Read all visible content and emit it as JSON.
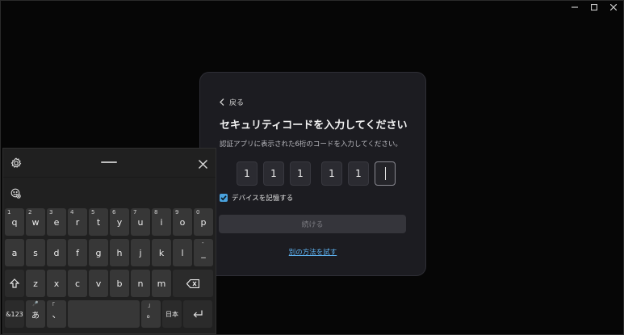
{
  "window": {
    "controls": [
      "minimize-icon",
      "maximize-icon",
      "close-icon"
    ]
  },
  "dialog": {
    "back_label": "戻る",
    "title": "セキュリティコードを入力してください",
    "subtitle": "認証アプリに表示された6桁のコードを入力してください。",
    "digits": [
      "1",
      "1",
      "1",
      "1",
      "1",
      ""
    ],
    "remember_label": "デバイスを記憶する",
    "remember_checked": true,
    "continue_label": "続ける",
    "other_method_link": "別の方法を試す",
    "accent_color": "#4aa3df",
    "link_color": "#5db0ee"
  },
  "keyboard": {
    "row1": [
      {
        "k": "q",
        "s": "1"
      },
      {
        "k": "w",
        "s": "2"
      },
      {
        "k": "e",
        "s": "3"
      },
      {
        "k": "r",
        "s": "4"
      },
      {
        "k": "t",
        "s": "5"
      },
      {
        "k": "y",
        "s": "6"
      },
      {
        "k": "u",
        "s": "7"
      },
      {
        "k": "i",
        "s": "8"
      },
      {
        "k": "o",
        "s": "9"
      },
      {
        "k": "p",
        "s": "0"
      }
    ],
    "row2": [
      {
        "k": "a",
        "s": ""
      },
      {
        "k": "s",
        "s": ""
      },
      {
        "k": "d",
        "s": ""
      },
      {
        "k": "f",
        "s": ""
      },
      {
        "k": "g",
        "s": ""
      },
      {
        "k": "h",
        "s": ""
      },
      {
        "k": "j",
        "s": ""
      },
      {
        "k": "k",
        "s": ""
      },
      {
        "k": "l",
        "s": ""
      },
      {
        "k": "_",
        "s": "-"
      }
    ],
    "row3": [
      {
        "k": "z",
        "s": ""
      },
      {
        "k": "x",
        "s": ""
      },
      {
        "k": "c",
        "s": ""
      },
      {
        "k": "v",
        "s": ""
      },
      {
        "k": "b",
        "s": ""
      },
      {
        "k": "n",
        "s": ""
      },
      {
        "k": "m",
        "s": ""
      }
    ],
    "sym_key": "&123",
    "kana_key": "あ",
    "kana_sub": "🎤",
    "bracket_open_sub": "「",
    "comma_key": "、",
    "bracket_close_sub": "」",
    "period_key": "。",
    "lang_key": "日本"
  }
}
